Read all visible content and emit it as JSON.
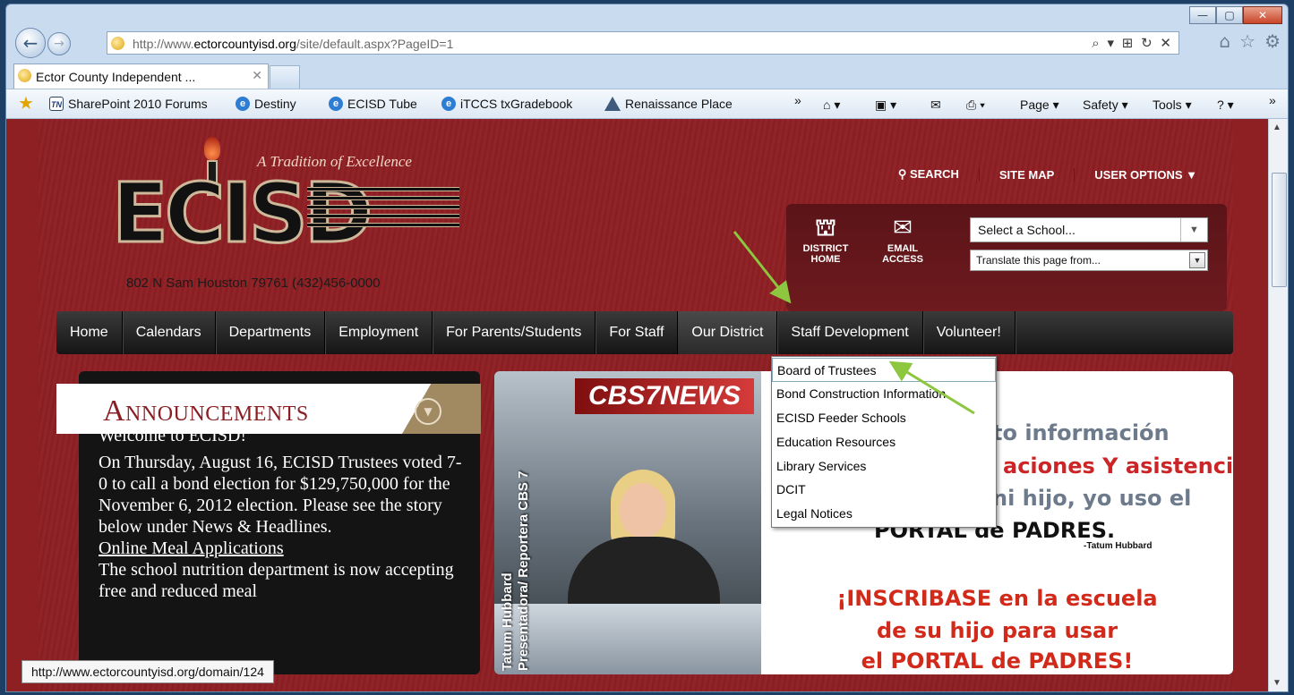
{
  "browser": {
    "url_prefix": "http://www.",
    "url_domain": "ectorcountyisd.org",
    "url_suffix": "/site/default.aspx?PageID=1",
    "addr_tools": "⌕ ▾ ⊞ ↻ ✕",
    "tab_title": "Ector County Independent ...",
    "tab_close": "✕",
    "window_buttons": [
      "—",
      "▢",
      "✕"
    ],
    "right_icons": [
      "⌂",
      "☆",
      "⚙"
    ],
    "favorites": [
      {
        "label": "SharePoint 2010 Forums",
        "icon": "tn-icon",
        "icon_text": "TN"
      },
      {
        "label": "Destiny",
        "icon": "ie-icon",
        "icon_text": "e"
      },
      {
        "label": "ECISD Tube",
        "icon": "ie-icon",
        "icon_text": "e"
      },
      {
        "label": "iTCCS txGradebook",
        "icon": "ie-icon",
        "icon_text": "e"
      },
      {
        "label": "Renaissance Place",
        "icon": "renaissance-icon",
        "icon_text": ""
      }
    ],
    "commands": {
      "overflow": "»",
      "home": "⌂ ▾",
      "feeds": "▣ ▾",
      "mail": "✉",
      "print": "⎙ ▾",
      "page": "Page ▾",
      "safety": "Safety ▾",
      "tools": "Tools ▾",
      "help": "? ▾",
      "overflow2": "»"
    },
    "status_url": "http://www.ectorcountyisd.org/domain/124"
  },
  "site": {
    "tagline": "A Tradition of Excellence",
    "logo_text": "ECISD",
    "address": "802 N Sam Houston 79761 (432)456-0000",
    "top_links": [
      "SEARCH",
      "SITE MAP",
      "USER OPTIONS ▼"
    ],
    "quick_links": [
      {
        "line1": "DISTRICT",
        "line2": "HOME",
        "icon": "district-home-icon",
        "glyph": "⛫"
      },
      {
        "line1": "EMAIL",
        "line2": "ACCESS",
        "icon": "email-icon",
        "glyph": "✉"
      }
    ],
    "school_select": "Select a School...",
    "translate_select": "Translate this page from...",
    "nav": [
      "Home",
      "Calendars",
      "Departments",
      "Employment",
      "For Parents/Students",
      "For Staff",
      "Our District",
      "Staff Development",
      "Volunteer!"
    ],
    "dropdown": [
      "Board of Trustees",
      "Bond Construction Information",
      "ECISD Feeder Schools",
      "Education Resources",
      "Library Services",
      "DCIT",
      "Legal Notices"
    ]
  },
  "announcements": {
    "title": "Announcements",
    "cutoff_heading": "Welcome to ECISD!",
    "paragraph": "On Thursday, August 16, ECISD Trustees voted 7-0 to call a bond election for $129,750,000 for the November 6, 2012 election. Please see the story below under News & Headlines.",
    "link": "Online Meal Applications",
    "paragraph2": "The school nutrition department is now accepting free and reduced meal"
  },
  "photo": {
    "banner": "CBS7NEWS",
    "caption_line1": "Tatum Hubbard",
    "caption_line2": "Presentadora/ Reportera CBS 7"
  },
  "promo": {
    "line1": "to información",
    "line2": "aciones Y asistencia",
    "line3": "ni hijo, yo uso el",
    "line4": "PORTAL de PADRES.",
    "signature": "-Tatum Hubbard",
    "line5": "¡INSCRIBASE en la escuela",
    "line6": "de su hijo para usar",
    "line7": "el PORTAL de PADRES!"
  },
  "colors": {
    "site_red": "#8e2024",
    "nav_dark": "#1a1a1a",
    "annotation_arrow": "#8dc63f"
  }
}
